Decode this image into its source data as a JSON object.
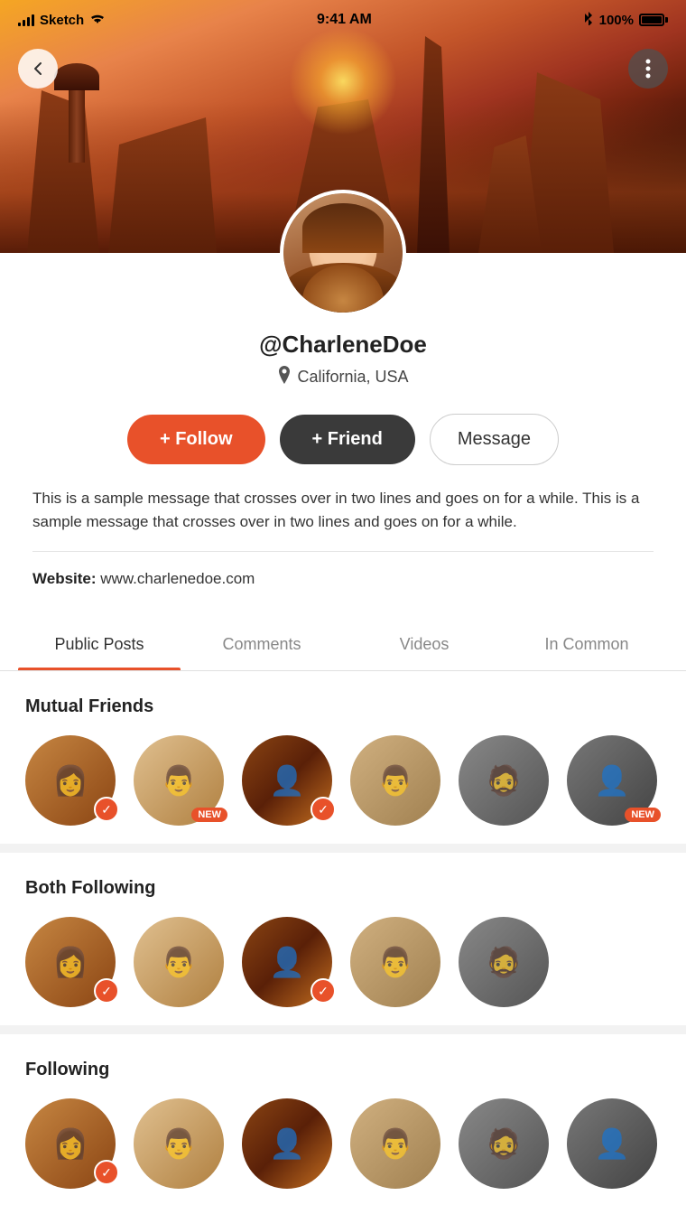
{
  "status_bar": {
    "carrier": "Sketch",
    "time": "9:41 AM",
    "bluetooth": "BT",
    "battery": "100%"
  },
  "header": {
    "back_label": "←",
    "more_label": "⋮"
  },
  "profile": {
    "username": "@CharleneDoe",
    "location": "California, USA",
    "bio": "This is a sample message that crosses over in two lines and goes on for a while. This is a sample message that crosses over in two lines and goes on for a while.",
    "website_label": "Website:",
    "website_url": "www.charlenedoe.com"
  },
  "buttons": {
    "follow": "+ Follow",
    "friend": "+ Friend",
    "message": "Message"
  },
  "tabs": [
    {
      "id": "public-posts",
      "label": "Public Posts",
      "active": true
    },
    {
      "id": "comments",
      "label": "Comments",
      "active": false
    },
    {
      "id": "videos",
      "label": "Videos",
      "active": false
    },
    {
      "id": "in-common",
      "label": "In Common",
      "active": false
    }
  ],
  "sections": {
    "mutual_friends": {
      "title": "Mutual Friends",
      "friends": [
        {
          "id": 1,
          "badge_type": "check"
        },
        {
          "id": 2,
          "badge_type": "new"
        },
        {
          "id": 3,
          "badge_type": "check"
        },
        {
          "id": 4,
          "badge_type": "none"
        },
        {
          "id": 5,
          "badge_type": "none"
        },
        {
          "id": 6,
          "badge_type": "new"
        }
      ]
    },
    "both_following": {
      "title": "Both Following",
      "friends": [
        {
          "id": 1,
          "badge_type": "check"
        },
        {
          "id": 2,
          "badge_type": "none"
        },
        {
          "id": 3,
          "badge_type": "check"
        },
        {
          "id": 4,
          "badge_type": "none"
        },
        {
          "id": 5,
          "badge_type": "none"
        }
      ]
    },
    "following": {
      "title": "Following",
      "friends": [
        {
          "id": 1,
          "badge_type": "check"
        },
        {
          "id": 2,
          "badge_type": "none"
        },
        {
          "id": 3,
          "badge_type": "none"
        },
        {
          "id": 4,
          "badge_type": "none"
        },
        {
          "id": 5,
          "badge_type": "none"
        },
        {
          "id": 6,
          "badge_type": "none"
        }
      ]
    }
  }
}
